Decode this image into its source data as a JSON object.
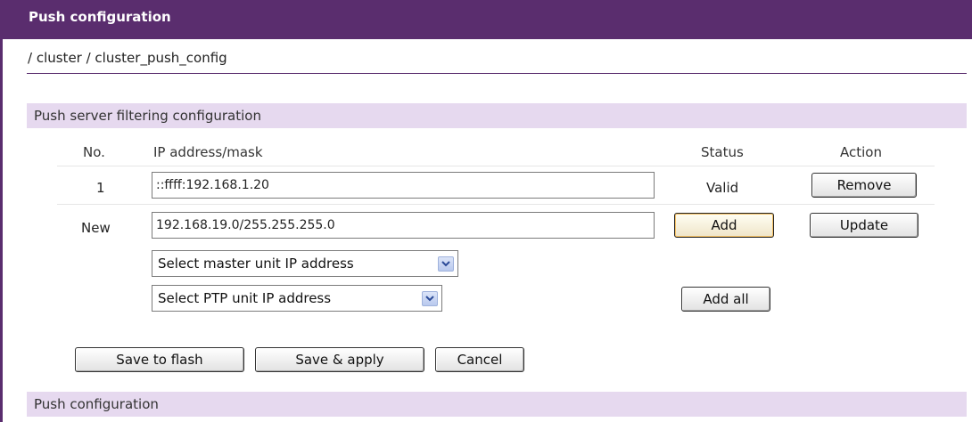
{
  "header": {
    "title": "Push configuration"
  },
  "breadcrumb": "/ cluster / cluster_push_config",
  "filtering": {
    "section_title": "Push server filtering configuration",
    "columns": {
      "no": "No.",
      "ip": "IP address/mask",
      "status": "Status",
      "action": "Action"
    },
    "rows": [
      {
        "no": "1",
        "ip": "::ffff:192.168.1.20",
        "status": "Valid",
        "action_label": "Remove"
      }
    ],
    "new_row": {
      "label": "New",
      "ip": "192.168.19.0/255.255.255.0",
      "add_label": "Add",
      "update_label": "Update",
      "master_select": "Select master unit IP address",
      "ptp_select": "Select PTP unit IP address",
      "add_all_label": "Add all"
    }
  },
  "buttons": {
    "save_flash": "Save to flash",
    "save_apply": "Save & apply",
    "cancel": "Cancel"
  },
  "push_section_title": "Push configuration",
  "colors": {
    "header_bg": "#5a2d6e",
    "section_bg": "#e6d9ef"
  },
  "icons": [
    "chevron-down-icon"
  ]
}
